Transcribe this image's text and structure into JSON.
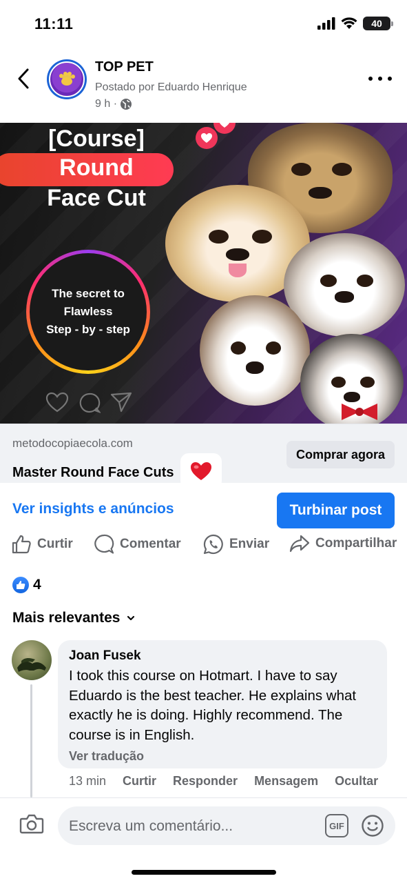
{
  "status_bar": {
    "time": "11:11",
    "battery": "40"
  },
  "post": {
    "page_name": "TOP PET",
    "posted_by": "Postado por Eduardo Henrique",
    "time": "9 h ·",
    "creative": {
      "line1": "[Course]",
      "line2": "Round",
      "line3": "Face Cut",
      "ring_line1": "The secret to",
      "ring_line2": "Flawless",
      "ring_line3": "Step - by - step"
    },
    "link": {
      "domain": "metodocopiaecola.com",
      "title": "Master Round Face Cuts",
      "cta": "Comprar agora"
    },
    "insights_label": "Ver insights e anúncios",
    "boost_label": "Turbinar post",
    "actions": {
      "like": "Curtir",
      "comment": "Comentar",
      "send": "Enviar",
      "share": "Compartilhar"
    },
    "reactions_count": "4",
    "sort_label": "Mais relevantes"
  },
  "comment": {
    "author": "Joan Fusek",
    "text": "I took this course on Hotmart. I have to say Eduardo is the best teacher. He explains what exactly he is doing. Highly recommend. The course is in English.",
    "translate": "Ver tradução",
    "time": "13 min",
    "like": "Curtir",
    "reply": "Responder",
    "message": "Mensagem",
    "hide": "Ocultar"
  },
  "composer": {
    "placeholder": "Escreva um comentário...",
    "gif": "GIF"
  },
  "colors": {
    "accent": "#1877f2",
    "text": "#050505",
    "secondary": "#65676b",
    "surface": "#f0f2f5"
  }
}
